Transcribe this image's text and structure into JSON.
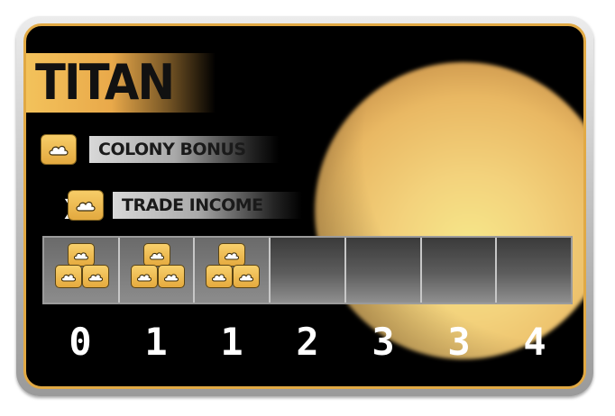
{
  "card": {
    "title": "TITAN",
    "resource_icon": "cloud-icon",
    "colors": {
      "border": "#e1a944",
      "tile": "#efba52",
      "background": "#000000"
    }
  },
  "colony_bonus": {
    "label": "COLONY BONUS",
    "icon": "cloud-icon"
  },
  "trade_income": {
    "multiplier": "X",
    "label": "TRADE INCOME",
    "icon": "cloud-icon"
  },
  "track": {
    "slots": [
      {
        "value": "0",
        "filled": true
      },
      {
        "value": "1",
        "filled": true
      },
      {
        "value": "1",
        "filled": true
      },
      {
        "value": "2",
        "filled": false
      },
      {
        "value": "3",
        "filled": false
      },
      {
        "value": "3",
        "filled": false
      },
      {
        "value": "4",
        "filled": false
      }
    ]
  }
}
